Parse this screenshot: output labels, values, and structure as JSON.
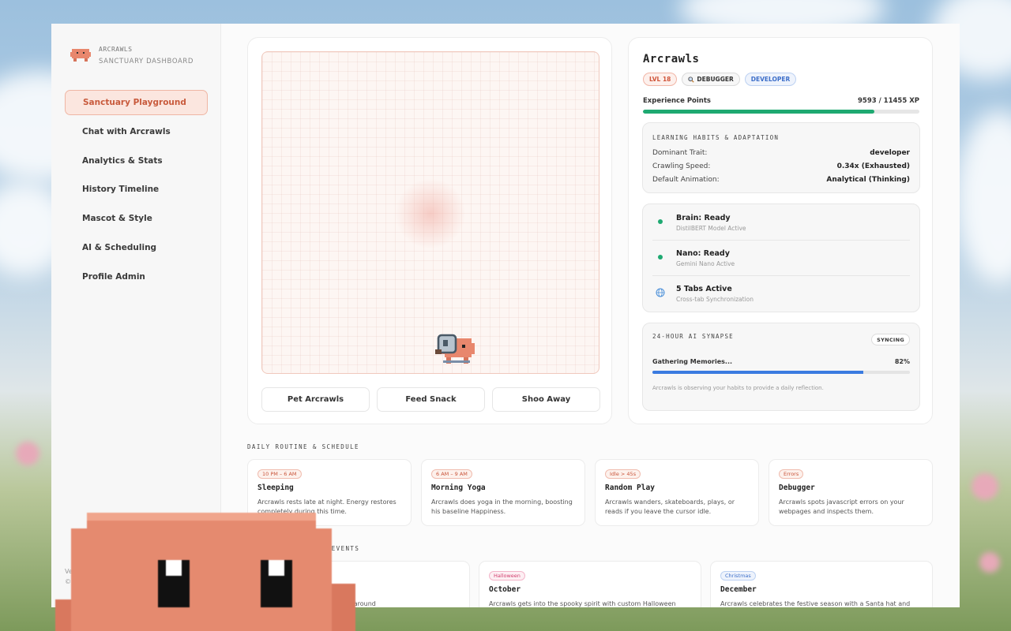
{
  "brand": {
    "name": "ARCRAWLS",
    "subtitle": "SANCTUARY DASHBOARD"
  },
  "nav": {
    "items": [
      {
        "label": "Sanctuary Playground",
        "active": true
      },
      {
        "label": "Chat with Arcrawls"
      },
      {
        "label": "Analytics & Stats"
      },
      {
        "label": "History Timeline"
      },
      {
        "label": "Mascot & Style"
      },
      {
        "label": "AI & Scheduling"
      },
      {
        "label": "Profile Admin"
      }
    ]
  },
  "sidebar_footer": {
    "line1": "Ver",
    "line2": "© 2"
  },
  "playground": {
    "actions": [
      "Pet Arcrawls",
      "Feed Snack",
      "Shoo Away"
    ]
  },
  "profile": {
    "name": "Arcrawls",
    "badges": {
      "level": "LVL 18",
      "debugger": "DEBUGGER",
      "developer": "DEVELOPER"
    },
    "badge_icon": "magnifier-icon",
    "xp": {
      "label": "Experience Points",
      "value": "9593 / 11455 XP",
      "fraction": 0.8374
    },
    "habits": {
      "title": "Learning Habits & Adaptation",
      "rows": [
        {
          "key": "Dominant Trait:",
          "value": "developer"
        },
        {
          "key": "Crawling Speed:",
          "value": "0.34x (Exhausted)"
        },
        {
          "key": "Default Animation:",
          "value": "Analytical (Thinking)"
        }
      ]
    },
    "status": [
      {
        "title": "Brain: Ready",
        "sub": "DistilBERT Model Active",
        "icon": "green-dot"
      },
      {
        "title": "Nano: Ready",
        "sub": "Gemini Nano Active",
        "icon": "green-dot"
      },
      {
        "title": "5 Tabs Active",
        "sub": "Cross-tab Synchronization",
        "icon": "globe-icon"
      }
    ],
    "synapse": {
      "title": "24-Hour AI Synapse",
      "badge": "SYNCING",
      "progress_label": "Gathering Memories...",
      "progress_value": "82%",
      "progress_fraction": 0.82,
      "note": "Arcrawls is observing your habits to provide a daily reflection."
    }
  },
  "schedule": {
    "title": "Daily Routine & Schedule",
    "cards": [
      {
        "tag": "10 PM – 6 AM",
        "title": "Sleeping",
        "desc": "Arcrawls rests late at night. Energy restores completely during this time."
      },
      {
        "tag": "6 AM – 9 AM",
        "title": "Morning Yoga",
        "desc": "Arcrawls does yoga in the morning, boosting his baseline Happiness."
      },
      {
        "tag": "Idle > 45s",
        "title": "Random Play",
        "desc": "Arcrawls wanders, skateboards, plays, or reads if you leave the cursor idle."
      },
      {
        "tag": "Errors",
        "title": "Debugger",
        "desc": "Arcrawls spots javascript errors on your webpages and inspects them."
      }
    ]
  },
  "seasonal": {
    "title_fragment": "AR EVENTS",
    "cards": [
      {
        "tag": "",
        "title": "",
        "desc": "s, enjoys ice cream, and surfs around"
      },
      {
        "tag": "Halloween",
        "title": "October",
        "desc": "Arcrawls gets into the spooky spirit with custom Halloween"
      },
      {
        "tag": "Christmas",
        "title": "December",
        "desc": "Arcrawls celebrates the festive season with a Santa hat and"
      }
    ]
  },
  "colors": {
    "accent": "#e0735a",
    "success": "#1ea971",
    "progress": "#3a7be0"
  }
}
